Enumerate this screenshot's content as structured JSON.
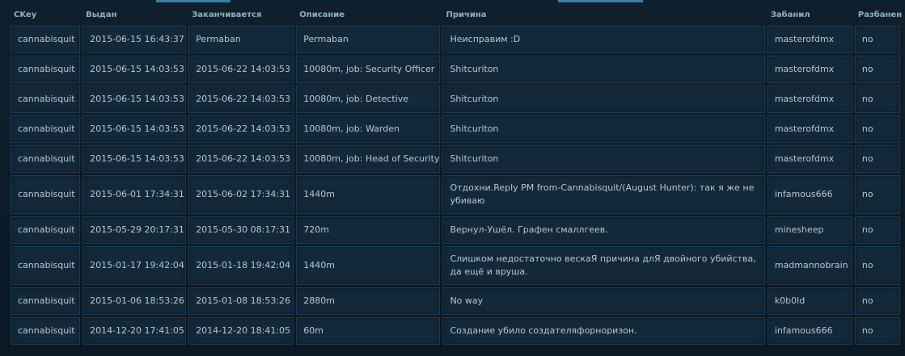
{
  "headers": [
    "CKey",
    "Выдан",
    "Заканчивается",
    "Описание",
    "Причина",
    "Забанил",
    "Разбанен"
  ],
  "rows": [
    [
      "cannabisquit",
      "2015-06-15 16:43:37",
      "Permaban",
      "Permaban",
      "Неисправим :D",
      "masterofdmx",
      "no"
    ],
    [
      "cannabisquit",
      "2015-06-15 14:03:53",
      "2015-06-22 14:03:53",
      "10080m, job: Security Officer",
      "Shitcuriton",
      "masterofdmx",
      "no"
    ],
    [
      "cannabisquit",
      "2015-06-15 14:03:53",
      "2015-06-22 14:03:53",
      "10080m, job: Detective",
      "Shitcuriton",
      "masterofdmx",
      "no"
    ],
    [
      "cannabisquit",
      "2015-06-15 14:03:53",
      "2015-06-22 14:03:53",
      "10080m, job: Warden",
      "Shitcuriton",
      "masterofdmx",
      "no"
    ],
    [
      "cannabisquit",
      "2015-06-15 14:03:53",
      "2015-06-22 14:03:53",
      "10080m, job: Head of Security",
      "Shitcuriton",
      "masterofdmx",
      "no"
    ],
    [
      "cannabisquit",
      "2015-06-01 17:34:31",
      "2015-06-02 17:34:31",
      "1440m",
      "Отдохни.Reply PM from-Cannabisquit/(August Hunter): так я же не убиваю",
      "infamous666",
      "no"
    ],
    [
      "cannabisquit",
      "2015-05-29 20:17:31",
      "2015-05-30 08:17:31",
      "720m",
      "Вернул-Ушёл. Графен смаллгеев.",
      "minesheep",
      "no"
    ],
    [
      "cannabisquit",
      "2015-01-17 19:42:04",
      "2015-01-18 19:42:04",
      "1440m",
      "Слишком недостаточно вескаЯ причина длЯ двойного убийства, да ещё и вруша.",
      "madmannobrain",
      "no"
    ],
    [
      "cannabisquit",
      "2015-01-06 18:53:26",
      "2015-01-08 18:53:26",
      "2880m",
      "No way",
      "k0b0ld",
      "no"
    ],
    [
      "cannabisquit",
      "2014-12-20 17:41:05",
      "2014-12-20 18:41:05",
      "60m",
      "Создание убило создателяфорноризон.",
      "infamous666",
      "no"
    ]
  ]
}
